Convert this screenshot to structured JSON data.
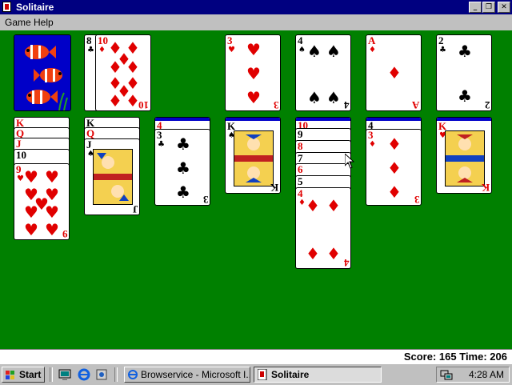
{
  "window": {
    "title": "Solitaire"
  },
  "menu": {
    "game": "Game",
    "help": "Help"
  },
  "status": {
    "score_label": "Score:",
    "score": "165",
    "time_label": "Time:",
    "time": "206"
  },
  "taskbar": {
    "start": "Start",
    "tasks": [
      {
        "label": "Browservice - Microsoft I...",
        "active": false
      },
      {
        "label": "Solitaire",
        "active": true
      }
    ],
    "clock": "4:28 AM"
  },
  "cards": {
    "waste_back": "8",
    "waste": "10",
    "f1": "3",
    "f2": "4",
    "f3": "A",
    "f4": "2",
    "t1": [
      "K",
      "Q",
      "J",
      "10",
      "9"
    ],
    "t2": [
      "K",
      "Q",
      "J"
    ],
    "t3": [
      "4",
      "3"
    ],
    "t4": [
      "K"
    ],
    "t5": [
      "10",
      "9",
      "8",
      "7",
      "6",
      "5",
      "4"
    ],
    "t6": [
      "4",
      "3"
    ],
    "t7": [
      "K"
    ]
  },
  "colors": {
    "felt": "#008000",
    "title": "#000080",
    "red": "#e00000",
    "back": "#0000c8"
  }
}
